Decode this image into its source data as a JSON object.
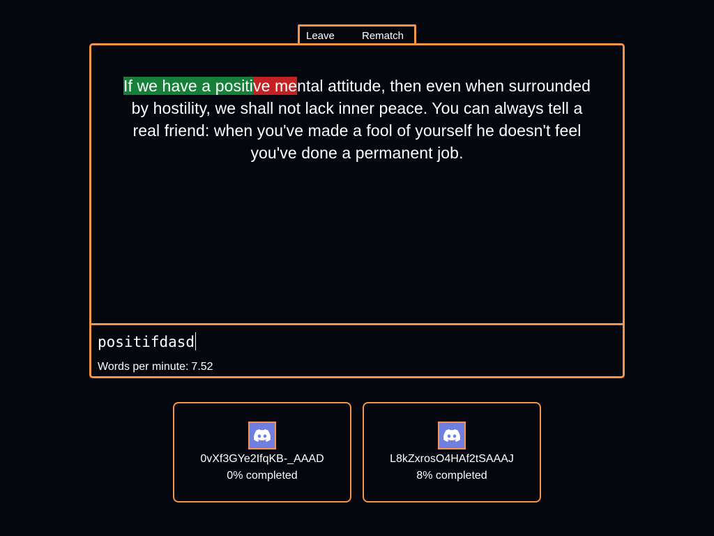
{
  "header": {
    "leave_label": "Leave",
    "rematch_label": "Rematch"
  },
  "quote": {
    "correct": "If we have a positi",
    "incorrect": "ve me",
    "remaining": "ntal attitude, then even when surrounded by hostility, we shall not lack inner peace. You can always tell a real friend: when you've made a fool of yourself he doesn't feel you've done a permanent job."
  },
  "input": {
    "value": "positifdasd"
  },
  "stats": {
    "wpm_label": "Words per minute:",
    "wpm_value": "7.52"
  },
  "players": [
    {
      "name": "0vXf3GYe2IfqKB-_AAAD",
      "progress": "0% completed",
      "avatar_icon": "discord-icon"
    },
    {
      "name": "L8kZxrosO4HAf2tSAAAJ",
      "progress": "8% completed",
      "avatar_icon": "discord-icon"
    }
  ],
  "colors": {
    "accent": "#f4964a",
    "background": "#05070f",
    "correct": "#16803a",
    "incorrect": "#c42222",
    "avatar_bg": "#6f7fe0"
  }
}
